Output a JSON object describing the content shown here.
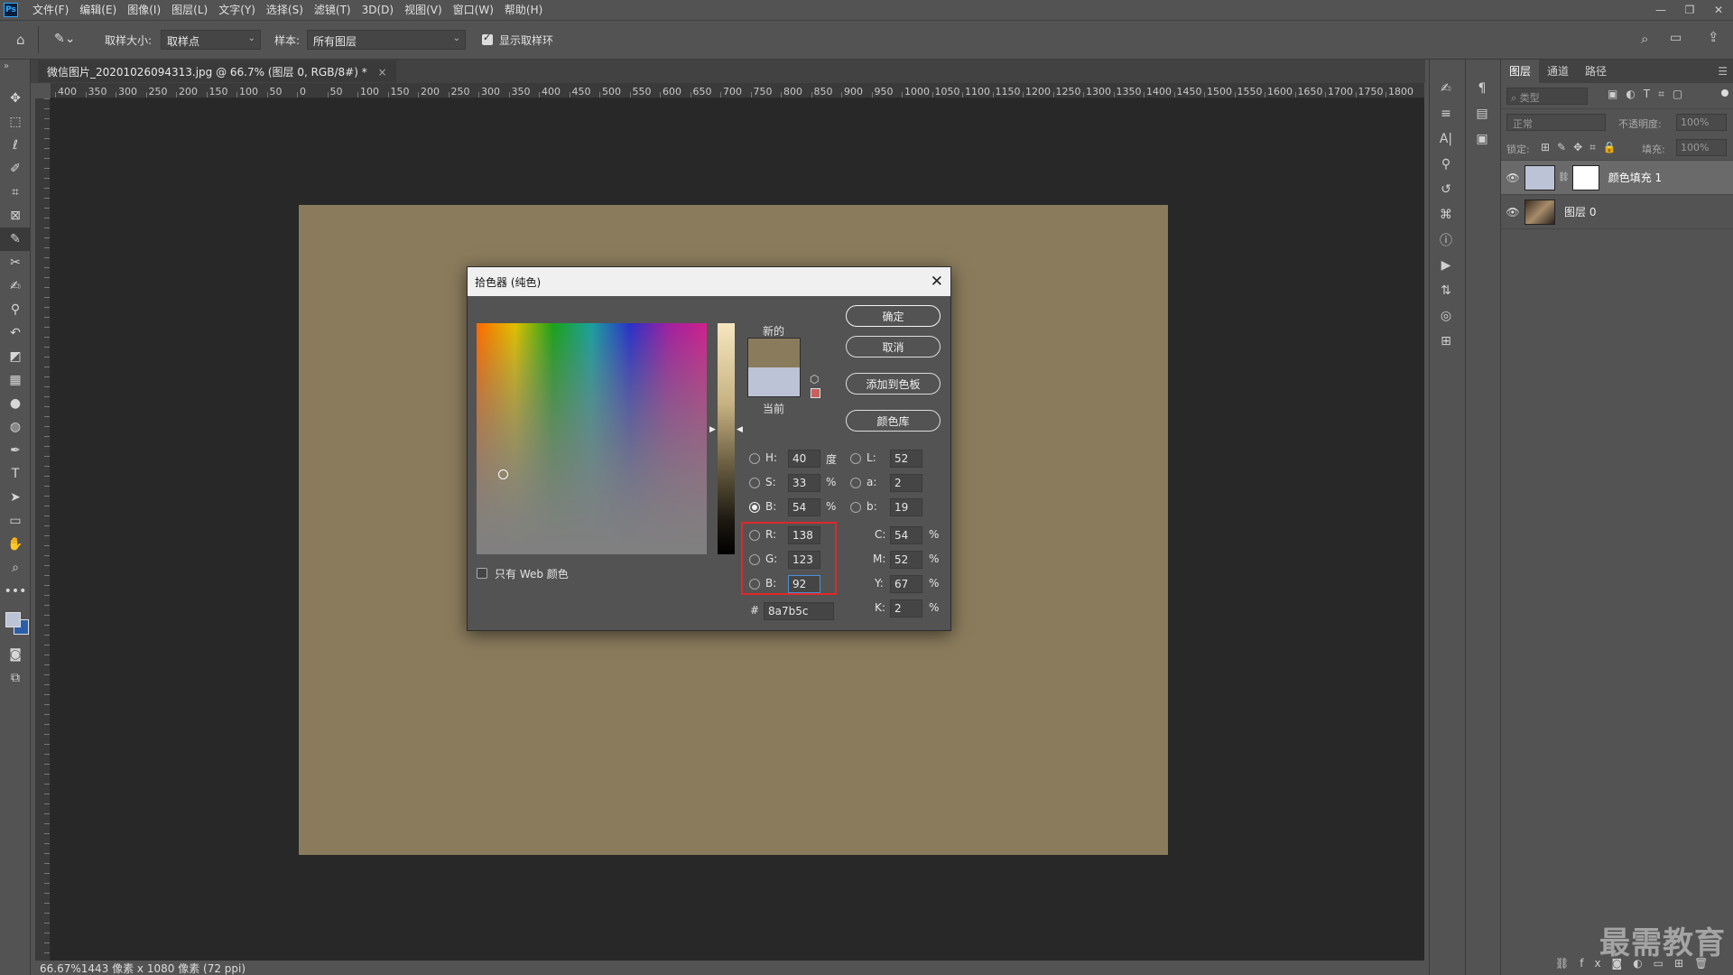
{
  "app": {
    "logo": "Ps",
    "menu": [
      "文件(F)",
      "编辑(E)",
      "图像(I)",
      "图层(L)",
      "文字(Y)",
      "选择(S)",
      "滤镜(T)",
      "3D(D)",
      "视图(V)",
      "窗口(W)",
      "帮助(H)"
    ]
  },
  "options_bar": {
    "sample_size_label": "取样大小:",
    "sample_size_value": "取样点",
    "sample_label": "样本:",
    "sample_value": "所有图层",
    "show_ring_label": "显示取样环"
  },
  "document": {
    "tab_title": "微信图片_20201026094313.jpg @ 66.7% (图层 0, RGB/8#) *",
    "tab_close": "×",
    "fill_color": "#8a7b5c"
  },
  "ruler_h_labels": [
    "400",
    "350",
    "300",
    "250",
    "200",
    "150",
    "100",
    "50",
    "0",
    "50",
    "100",
    "150",
    "200",
    "250",
    "300",
    "350",
    "400",
    "450",
    "500",
    "550",
    "600",
    "650",
    "700",
    "750",
    "800",
    "850",
    "900",
    "950",
    "1000",
    "1050",
    "1100",
    "1150",
    "1200",
    "1250",
    "1300",
    "1350",
    "1400",
    "1450",
    "1500",
    "1550",
    "1600",
    "1650",
    "1700",
    "1750",
    "1800"
  ],
  "status": {
    "text": "66.67%1443 像素 x 1080 像素 (72 ppi)"
  },
  "layers_panel": {
    "tabs": [
      "图层",
      "通道",
      "路径"
    ],
    "search_placeholder": "类型",
    "blend_mode": "正常",
    "opacity_label": "不透明度:",
    "opacity_value": "100%",
    "lock_label": "锁定:",
    "fill_label": "填充:",
    "fill_value": "100%",
    "layers": [
      {
        "name": "颜色填充 1",
        "selected": true,
        "thumb_color": "#bdc3d6"
      },
      {
        "name": "图层 0",
        "selected": false
      }
    ]
  },
  "dialog": {
    "title": "拾色器 (纯色)",
    "new_label": "新的",
    "current_label": "当前",
    "new_color": "#8a7b5c",
    "current_color": "#bdc3d6",
    "buttons": {
      "ok": "确定",
      "cancel": "取消",
      "add_swatch": "添加到色板",
      "color_library": "颜色库"
    },
    "web_only_label": "只有 Web 颜色",
    "hsb": {
      "h_label": "H:",
      "h_value": "40",
      "h_unit": "度",
      "s_label": "S:",
      "s_value": "33",
      "s_unit": "%",
      "b_label": "B:",
      "b_value": "54",
      "b_unit": "%"
    },
    "lab": {
      "l_label": "L:",
      "l_value": "52",
      "a_label": "a:",
      "a_value": "2",
      "b_label": "b:",
      "b_value": "19"
    },
    "rgb": {
      "r_label": "R:",
      "r_value": "138",
      "g_label": "G:",
      "g_value": "123",
      "b_label": "B:",
      "b_value": "92"
    },
    "cmyk": {
      "c_label": "C:",
      "c_value": "54",
      "m_label": "M:",
      "m_value": "52",
      "y_label": "Y:",
      "y_value": "67",
      "k_label": "K:",
      "k_value": "2",
      "unit": "%"
    },
    "hex_label": "#",
    "hex_value": "8a7b5c"
  },
  "watermark": "最需教育"
}
